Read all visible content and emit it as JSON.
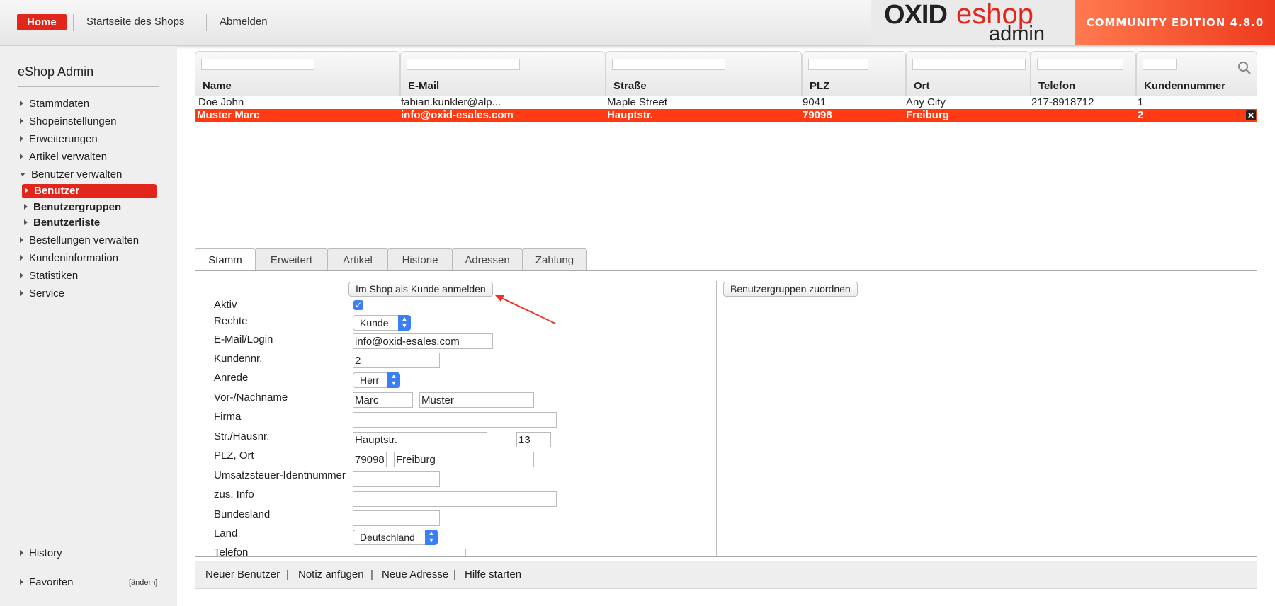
{
  "header": {
    "home": "Home",
    "shop_start": "Startseite des Shops",
    "logout": "Abmelden",
    "logo_oxid": "OXID",
    "logo_eshop": "eshop",
    "logo_admin": "admin",
    "edition": "COMMUNITY EDITION 4.8.0"
  },
  "sidebar": {
    "title": "eShop Admin",
    "items": [
      "Stammdaten",
      "Shopeinstellungen",
      "Erweiterungen",
      "Artikel verwalten"
    ],
    "expanded": "Benutzer verwalten",
    "sub_items": [
      "Benutzer",
      "Benutzergruppen",
      "Benutzerliste"
    ],
    "items_after": [
      "Bestellungen verwalten",
      "Kundeninformation",
      "Statistiken",
      "Service"
    ],
    "history": "History",
    "favorites": "Favoriten",
    "change": "[ändern]"
  },
  "grid": {
    "columns": [
      "Name",
      "E-Mail",
      "Straße",
      "PLZ",
      "Ort",
      "Telefon",
      "Kundennummer"
    ],
    "rows": [
      [
        "Doe John",
        "fabian.kunkler@alp...",
        "Maple Street",
        "9041",
        "Any City",
        "217-8918712",
        "1"
      ],
      [
        "Muster Marc",
        "info@oxid-esales.com",
        "Hauptstr.",
        "79098",
        "Freiburg",
        "",
        "2"
      ]
    ]
  },
  "tabs": [
    "Stamm",
    "Erweitert",
    "Artikel",
    "Historie",
    "Adressen",
    "Zahlung"
  ],
  "form": {
    "login_as_customer": "Im Shop als Kunde anmelden",
    "assign_groups": "Benutzergruppen zuordnen",
    "labels": [
      "Aktiv",
      "Rechte",
      "E-Mail/Login",
      "Kundennr.",
      "Anrede",
      "Vor-/Nachname",
      "Firma",
      "Str./Hausnr.",
      "PLZ, Ort",
      "Umsatzsteuer-Identnummer",
      "zus. Info",
      "Bundesland",
      "Land",
      "Telefon"
    ],
    "rights": "Kunde",
    "email": "info@oxid-esales.com",
    "customer_no": "2",
    "salutation": "Herr",
    "firstname": "Marc",
    "lastname": "Muster",
    "company": "",
    "street": "Hauptstr.",
    "house_no": "13",
    "zip": "79098",
    "city": "Freiburg",
    "vat_id": "",
    "add_info": "",
    "state": "",
    "country": "Deutschland",
    "phone": "",
    "active": true
  },
  "footer": [
    "Neuer Benutzer",
    "Notiz anfügen",
    "Neue Adresse",
    "Hilfe starten"
  ],
  "colors": {
    "accent": "#e2261b",
    "selected_row": "#ff3b16",
    "select_arrow": "#3b7ff5"
  }
}
